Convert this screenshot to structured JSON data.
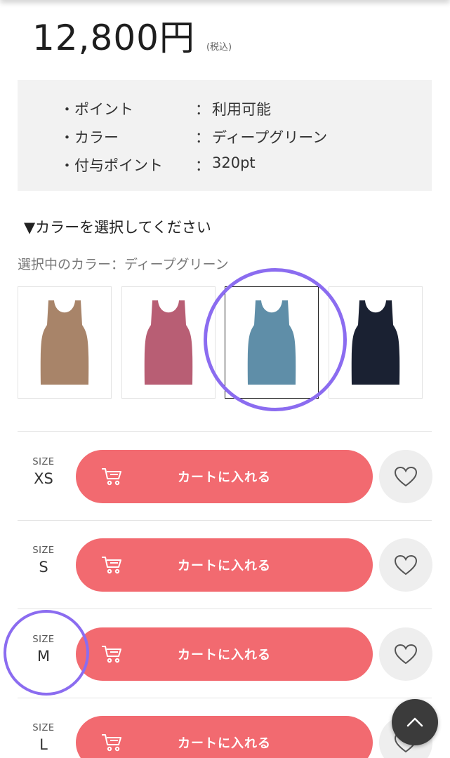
{
  "price": {
    "amount": "12,800円",
    "tax_note": "(税込)"
  },
  "info": [
    {
      "label": "・ポイント",
      "colon": "：",
      "value": "利用可能"
    },
    {
      "label": "・カラー",
      "colon": "：",
      "value": "ディープグリーン"
    },
    {
      "label": "・付与ポイント",
      "colon": "：",
      "value": "320pt"
    }
  ],
  "color_select": {
    "heading": "▼カラーを選択してください",
    "current_label": "選択中のカラー：ディープグリーン",
    "swatches": [
      {
        "name": "beige",
        "color": "#a88469",
        "selected": false
      },
      {
        "name": "rose",
        "color": "#b85e74",
        "selected": false
      },
      {
        "name": "blue-green",
        "color": "#5f8ea8",
        "selected": true
      },
      {
        "name": "navy",
        "color": "#1a2132",
        "selected": false
      }
    ]
  },
  "sizes": [
    {
      "small_label": "SIZE",
      "size": "XS",
      "cart_label": "カートに入れる"
    },
    {
      "small_label": "SIZE",
      "size": "S",
      "cart_label": "カートに入れる"
    },
    {
      "small_label": "SIZE",
      "size": "M",
      "cart_label": "カートに入れる"
    },
    {
      "small_label": "SIZE",
      "size": "L",
      "cart_label": "カートに入れる"
    }
  ],
  "icons": {
    "cart": "cart-icon",
    "favorite": "heart-icon",
    "scroll_top": "chevron-up-icon"
  },
  "colors": {
    "cart_button": "#f26a70",
    "annotation_circle": "#8b6cf0",
    "info_bg": "#f2f2f2",
    "scroll_top_bg": "#3b3b3b"
  }
}
